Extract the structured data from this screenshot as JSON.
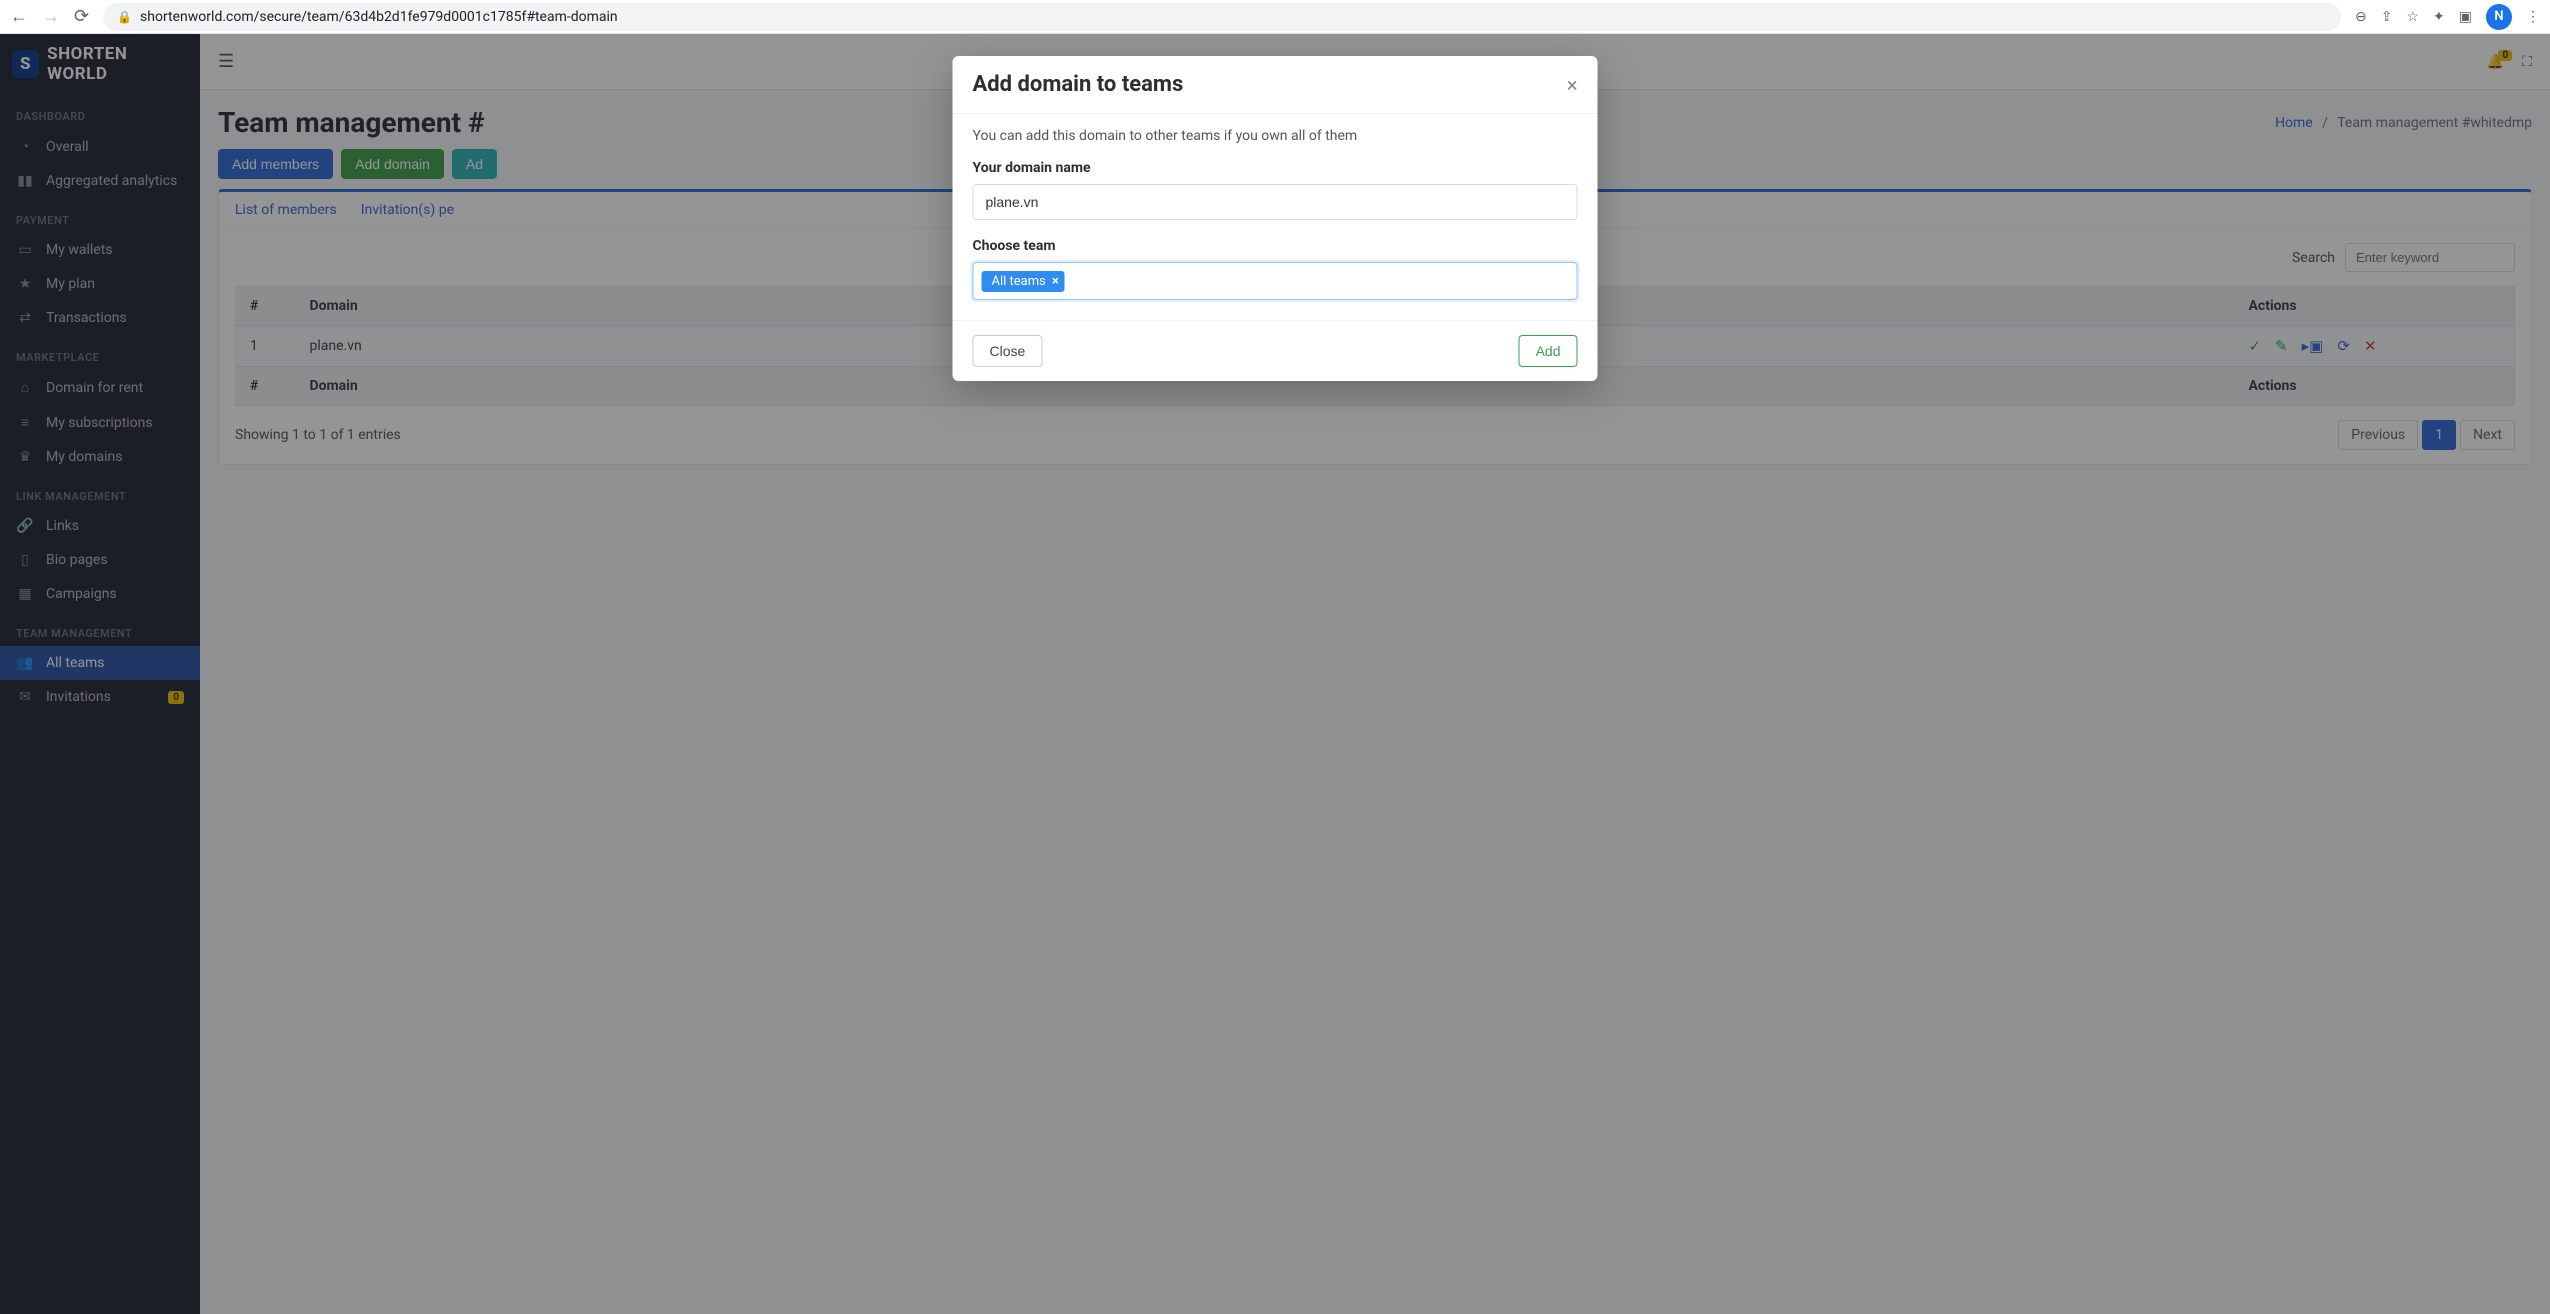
{
  "browser": {
    "url": "shortenworld.com/secure/team/63d4b2d1fe979d0001c1785f#team-domain",
    "avatar_initial": "N"
  },
  "brand": {
    "logo_letter": "S",
    "name": "SHORTEN WORLD"
  },
  "sidebar": {
    "sections": {
      "dashboard": "DASHBOARD",
      "payment": "PAYMENT",
      "marketplace": "MARKETPLACE",
      "link_mgmt": "LINK MANAGEMENT",
      "team_mgmt": "TEAM MANAGEMENT"
    },
    "items": {
      "overall": "Overall",
      "aggregated": "Aggregated analytics",
      "wallets": "My wallets",
      "plan": "My plan",
      "transactions": "Transactions",
      "domain_rent": "Domain for rent",
      "subscriptions": "My subscriptions",
      "my_domains": "My domains",
      "links": "Links",
      "bio": "Bio pages",
      "campaigns": "Campaigns",
      "all_teams": "All teams",
      "invitations": "Invitations",
      "invitations_badge": "0"
    }
  },
  "topbar": {
    "bell_badge": "0"
  },
  "page": {
    "title": "Team management #",
    "breadcrumb_home": "Home",
    "breadcrumb_sep": "/",
    "breadcrumb_current": "Team management #whitedmp"
  },
  "buttons": {
    "add_members": "Add members",
    "add_domain": "Add domain",
    "add_other": "Ad"
  },
  "tabs": {
    "list_members": "List of members",
    "invitations_pending": "Invitation(s) pe"
  },
  "search": {
    "label": "Search",
    "placeholder": "Enter keyword"
  },
  "table": {
    "col_num": "#",
    "col_domain": "Domain",
    "col_actions": "Actions",
    "rows": [
      {
        "num": "1",
        "domain": "plane.vn"
      }
    ],
    "entries_text": "Showing 1 to 1 of 1 entries"
  },
  "pagination": {
    "prev": "Previous",
    "page": "1",
    "next": "Next"
  },
  "modal": {
    "title": "Add domain to teams",
    "desc": "You can add this domain to other teams if you own all of them",
    "domain_label": "Your domain name",
    "domain_value": "plane.vn",
    "choose_team_label": "Choose team",
    "chip": "All teams",
    "chip_x": "×",
    "close": "Close",
    "add": "Add"
  }
}
